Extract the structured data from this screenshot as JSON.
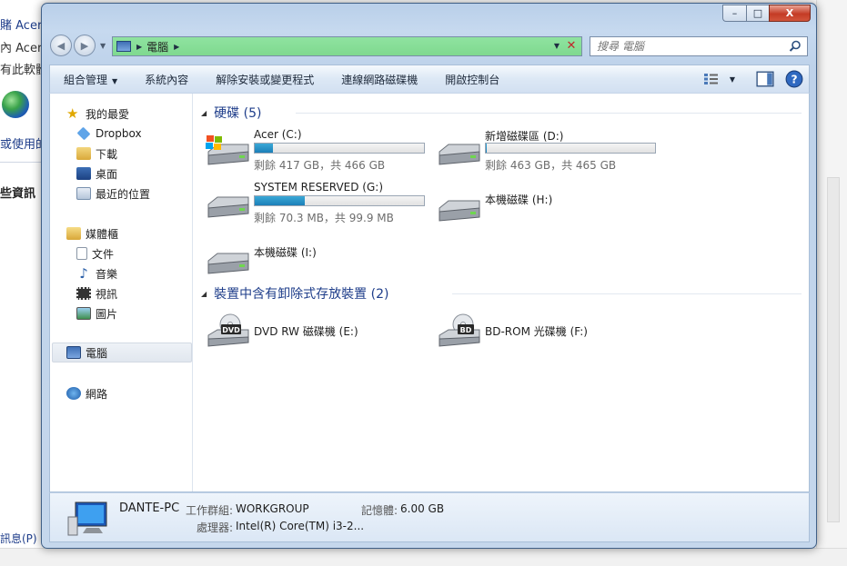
{
  "background": {
    "lines": [
      "賭 Acer",
      "內 Acer U",
      "有此軟體",
      "或使用的",
      "些資訊",
      "訊息(P)"
    ]
  },
  "window": {
    "controls": {
      "minimize": "–",
      "maximize": "□",
      "close": "X"
    }
  },
  "address": {
    "location": "電腦",
    "search_placeholder": "搜尋 電腦"
  },
  "toolbar": {
    "organize": "組合管理",
    "system_properties": "系統內容",
    "uninstall": "解除安裝或變更程式",
    "map_drive": "連線網路磁碟機",
    "control_panel": "開啟控制台"
  },
  "sidebar": {
    "favorites": "我的最愛",
    "dropbox": "Dropbox",
    "downloads": "下載",
    "desktop": "桌面",
    "recent": "最近的位置",
    "libraries": "媒體櫃",
    "documents": "文件",
    "music": "音樂",
    "videos": "視訊",
    "pictures": "圖片",
    "computer": "電腦",
    "network": "網路"
  },
  "groups": {
    "hdd": "硬碟 (5)",
    "removable": "裝置中含有卸除式存放裝置 (2)"
  },
  "drives": [
    {
      "name": "Acer (C:)",
      "free_text": "剩餘 417 GB，共 466 GB",
      "used_fraction": 0.105
    },
    {
      "name": "新增磁碟區 (D:)",
      "free_text": "剩餘 463 GB，共 465 GB",
      "used_fraction": 0.004
    },
    {
      "name": "SYSTEM RESERVED (G:)",
      "free_text": "剩餘 70.3 MB，共 99.9 MB",
      "used_fraction": 0.296
    },
    {
      "name": "本機磁碟 (H:)"
    },
    {
      "name": "本機磁碟 (I:)"
    }
  ],
  "removable": [
    {
      "name": "DVD RW 磁碟機 (E:)",
      "badge": "DVD"
    },
    {
      "name": "BD-ROM 光碟機 (F:)",
      "badge": "BD"
    }
  ],
  "details": {
    "pc_name": "DANTE-PC",
    "workgroup_label": "工作群組:",
    "workgroup": "WORKGROUP",
    "memory_label": "記憶體:",
    "memory": "6.00 GB",
    "processor_label": "處理器:",
    "processor": "Intel(R) Core(TM) i3-2..."
  }
}
